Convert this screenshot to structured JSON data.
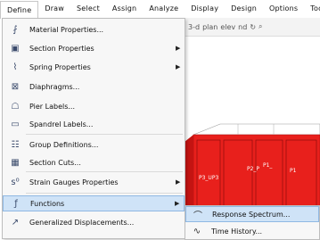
{
  "menubar": {
    "items": [
      "Define",
      "Draw",
      "Select",
      "Assign",
      "Analyze",
      "Display",
      "Design",
      "Options",
      "Tools"
    ]
  },
  "toolbar": {
    "items": [
      "3-d",
      "plan",
      "elev",
      "nd"
    ]
  },
  "define_menu": {
    "items": [
      {
        "label": "Material Properties...",
        "icon": "material-icon",
        "submenu": false
      },
      {
        "label": "Section Properties",
        "icon": "section-icon",
        "submenu": true
      },
      {
        "label": "Spring Properties",
        "icon": "spring-icon",
        "submenu": true
      },
      {
        "label": "Diaphragms...",
        "icon": "diaphragm-icon",
        "submenu": false
      },
      {
        "label": "Pier Labels...",
        "icon": "pier-icon",
        "submenu": false
      },
      {
        "label": "Spandrel Labels...",
        "icon": "spandrel-icon",
        "submenu": false
      },
      {
        "label": "Group Definitions...",
        "icon": "group-icon",
        "submenu": false
      },
      {
        "label": "Section Cuts...",
        "icon": "section-cut-icon",
        "submenu": false
      },
      {
        "label": "Strain Gauges Properties",
        "icon": "strain-gauge-icon",
        "submenu": true
      },
      {
        "label": "Functions",
        "icon": "functions-icon",
        "submenu": true
      },
      {
        "label": "Generalized Displacements...",
        "icon": "displacement-icon",
        "submenu": false
      }
    ]
  },
  "functions_submenu": {
    "items": [
      {
        "label": "Response Spectrum...",
        "icon": "response-spectrum-icon"
      },
      {
        "label": "Time History...",
        "icon": "time-history-icon"
      }
    ]
  },
  "viewport": {
    "labels": [
      "P3_UP3",
      "P2_P",
      "P1_",
      "P1"
    ],
    "accent": "#e02020"
  }
}
